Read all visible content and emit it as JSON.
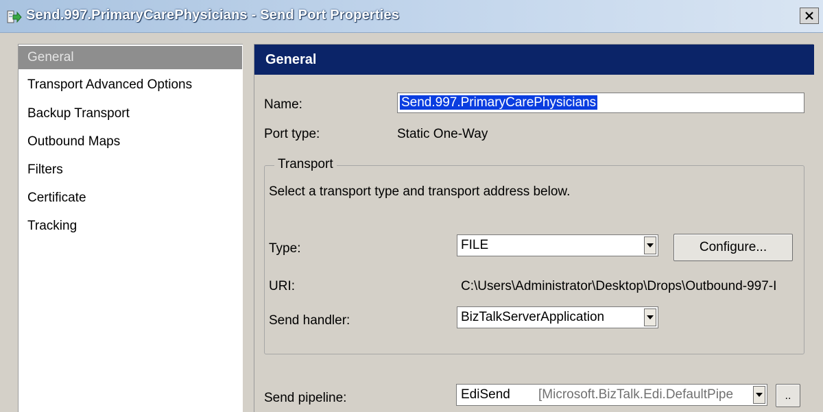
{
  "window": {
    "title": "Send.997.PrimaryCarePhysicians - Send Port Properties"
  },
  "sidebar": {
    "items": [
      {
        "label": "General"
      },
      {
        "label": "Transport Advanced Options"
      },
      {
        "label": "Backup Transport"
      },
      {
        "label": "Outbound Maps"
      },
      {
        "label": "Filters"
      },
      {
        "label": "Certificate"
      },
      {
        "label": "Tracking"
      }
    ],
    "selected": "General"
  },
  "general": {
    "header": "General",
    "name_label": "Name:",
    "name_value": "Send.997.PrimaryCarePhysicians",
    "port_type_label": "Port type:",
    "port_type_value": "Static One-Way",
    "transport": {
      "legend": "Transport",
      "instruction": "Select a transport type and transport address below.",
      "type_label": "Type:",
      "type_value": "FILE",
      "configure_label": "Configure...",
      "uri_label": "URI:",
      "uri_value": "C:\\Users\\Administrator\\Desktop\\Drops\\Outbound-997-I",
      "handler_label": "Send handler:",
      "handler_value": "BizTalkServerApplication"
    },
    "pipeline": {
      "label": "Send pipeline:",
      "name": "EdiSend",
      "assembly": "[Microsoft.BizTalk.Edi.DefaultPipe",
      "browse_label": ".."
    }
  },
  "colors": {
    "header_bg": "#0b2468",
    "selection_bg": "#0a3de0",
    "selected_nav_bg": "#8e8e8e",
    "dialog_bg": "#d4d0c8"
  },
  "icons": {
    "title": "send-port-icon",
    "close": "close-icon",
    "dropdown": "chevron-down-icon"
  }
}
